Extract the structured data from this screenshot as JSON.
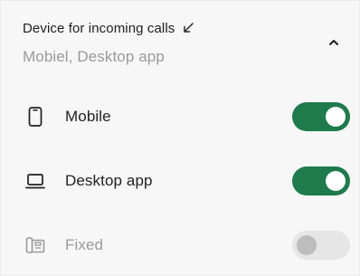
{
  "section": {
    "title": "Device for incoming calls",
    "summary": "Mobiel, Desktop app",
    "expanded": true,
    "title_icon": "arrow-down-left-icon",
    "collapse_icon": "chevron-up-icon"
  },
  "devices": [
    {
      "label": "Mobile",
      "icon": "smartphone-icon",
      "enabled": true,
      "disabled": false
    },
    {
      "label": "Desktop app",
      "icon": "laptop-icon",
      "enabled": true,
      "disabled": false
    },
    {
      "label": "Fixed",
      "icon": "desk-phone-icon",
      "enabled": false,
      "disabled": true
    }
  ],
  "colors": {
    "toggle_on": "#1f7a4c",
    "toggle_off": "#e6e6e6",
    "panel_bg": "#f7f7f7",
    "muted_text": "#9a9a9a"
  }
}
